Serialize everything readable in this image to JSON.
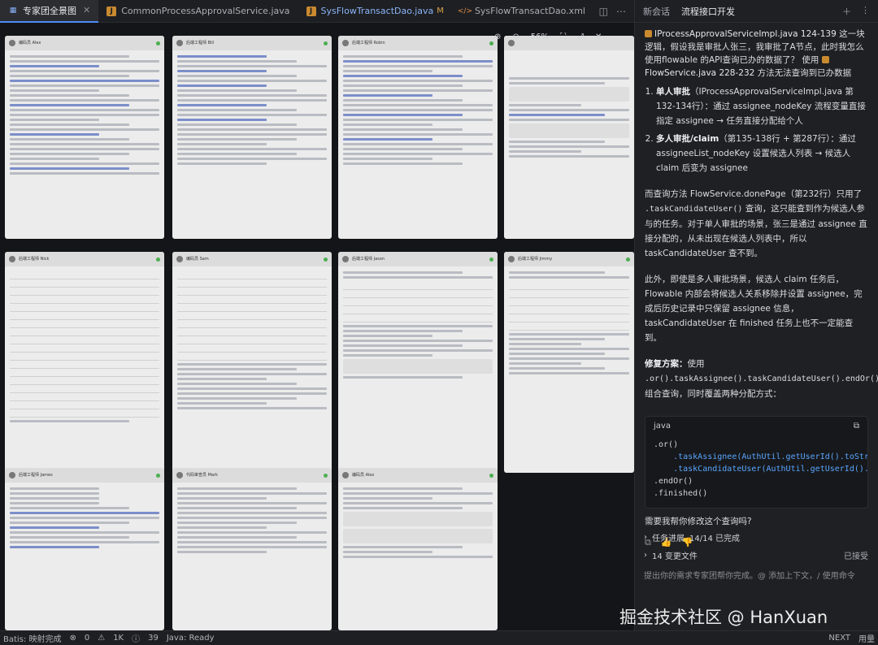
{
  "tabs": [
    {
      "label": "专家团全景图",
      "icon": "grid-icon",
      "active": true
    },
    {
      "label": "CommonProcessApprovalService.java",
      "icon": "java-file-icon"
    },
    {
      "label": "SysFlowTransactDao.java",
      "icon": "java-file-icon",
      "modified": "M"
    },
    {
      "label": "SysFlowTransactDao.xml",
      "icon": "xml-file-icon"
    }
  ],
  "zoom": {
    "level": "56%"
  },
  "cards": [
    {
      "name": "编码员 Alex"
    },
    {
      "name": "后端工程师 Bill"
    },
    {
      "name": "后端工程师 Robin"
    },
    {
      "name": ""
    },
    {
      "name": "后端工程师 Nick"
    },
    {
      "name": "编码员 Sam"
    },
    {
      "name": "后端工程师 Jason"
    },
    {
      "name": "后端工程师 Jimmy"
    },
    {
      "name": "后端工程师 James"
    },
    {
      "name": "代码审查员 Mark"
    },
    {
      "name": "编码员 Alex"
    }
  ],
  "panel": {
    "tabs": [
      "新会话",
      "流程接口开发"
    ],
    "context_file_1": "IProcessApprovalServiceImpl.java 124-139",
    "context_text_1": "这一块逻辑，假设我是审批人张三，我审批了A节点，此时我怎么使用flowable 的API查询已办的数据了？ 使用",
    "context_file_2": "FlowService.java 228-232",
    "context_text_2": "方法无法查询到已办数据",
    "list": [
      {
        "title": "单人审批",
        "text": "（IProcessApprovalServiceImpl.java 第132-134行）：通过 assignee_nodeKey 流程变量直接指定 assignee → 任务直接分配给个人"
      },
      {
        "title": "多人审批/claim",
        "text": "（第135-138行 + 第287行）：通过 assigneeList_nodeKey 设置候选人列表 → 候选人 claim 后变为 assignee"
      }
    ],
    "para1_a": "而查询方法 FlowService.donePage（第232行）只用了",
    "para1_code": ".taskCandidateUser()",
    "para1_b": "查询，这只能查到作为候选人参与的任务。对于单人审批的场景，张三是通过 assignee 直接分配的，从未出现在候选人列表中，所以 taskCandidateUser 查不到。",
    "para2": "此外，即使是多人审批场景，候选人 claim 任务后，Flowable 内部会将候选人关系移除并设置 assignee，完成后历史记录中只保留 assignee 信息，taskCandidateUser 在 finished 任务上也不一定能查到。",
    "fix_label": "修复方案：",
    "fix_text_a": "使用",
    "fix_code": ".or().taskAssignee().taskCandidateUser().endOr()",
    "fix_text_b": "组合查询，同时覆盖两种分配方式：",
    "code_lang": "java",
    "code_lines": [
      ".or()",
      "    .taskAssignee(AuthUtil.getUserId().toString(",
      "    .taskCandidateUser(AuthUtil.getUserId().toS",
      ".endOr()",
      ".finished()"
    ],
    "question": "需要我帮你修改这个查询吗?",
    "progress_label": "任务进展",
    "progress_value": "14/14 已完成",
    "changes_label": "14 变更文件",
    "changes_status": "已接受",
    "input_placeholder": "提出你的需求专家团帮你完成。@ 添加上下文，/ 使用命令"
  },
  "status": {
    "batis": "Batis: 映射完成",
    "errors": "0",
    "warnings": "1K",
    "info": "39",
    "java": "Java: Ready",
    "next": "NEXT",
    "usage": "用量"
  },
  "watermark": "掘金技术社区 @ HanXuan"
}
